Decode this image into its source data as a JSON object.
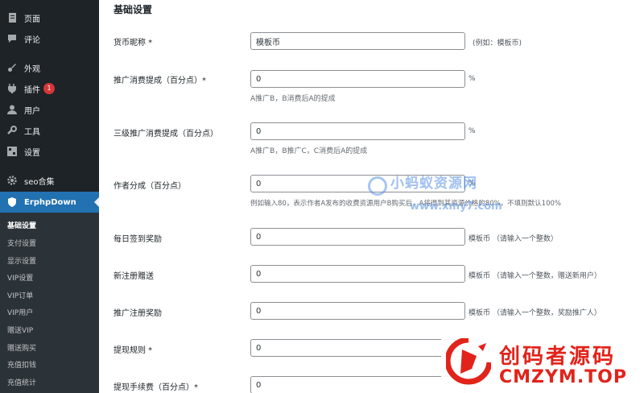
{
  "sidebar": {
    "menu": [
      {
        "label": "页面",
        "icon": "page-icon"
      },
      {
        "label": "评论",
        "icon": "comment-icon"
      },
      {
        "label": "外观",
        "icon": "brush-icon"
      },
      {
        "label": "插件",
        "icon": "plugin-icon",
        "badge": "1"
      },
      {
        "label": "用户",
        "icon": "user-icon"
      },
      {
        "label": "工具",
        "icon": "wrench-icon"
      },
      {
        "label": "设置",
        "icon": "settings-icon"
      },
      {
        "label": "seo合集",
        "icon": "gear-icon"
      },
      {
        "label": "ErphpDown",
        "icon": "shield-icon",
        "active": true
      }
    ],
    "submenu": [
      {
        "label": "基础设置",
        "current": true
      },
      {
        "label": "支付设置"
      },
      {
        "label": "显示设置"
      },
      {
        "label": "VIP设置"
      },
      {
        "label": "VIP订单"
      },
      {
        "label": "VIP用户"
      },
      {
        "label": "赠送VIP"
      },
      {
        "label": "赠送购买"
      },
      {
        "label": "充值扣钱"
      },
      {
        "label": "充值统计"
      }
    ]
  },
  "main": {
    "section_title": "基础设置",
    "rows": [
      {
        "label": "货币昵称 *",
        "value": "模板币",
        "suffix": "(例如：模板币)"
      },
      {
        "label": "推广消费提成（百分点）*",
        "value": "0",
        "suffix": "%",
        "hint": "A推广B，B消费后A的提成"
      },
      {
        "label": "三级推广消费提成（百分点）",
        "value": "0",
        "suffix": "%",
        "hint": "A推广B，B推广C，C消费后A的提成"
      },
      {
        "label": "作者分成（百分点）",
        "value": "0",
        "suffix": "%",
        "hint": "例如输入80，表示作者A发布的收费资源用户B购买后，A将得到其资源价格的80%，不填则默认100%"
      },
      {
        "label": "每日签到奖励",
        "value": "0",
        "suffix": "模板币 （请输入一个整数）"
      },
      {
        "label": "新注册赠送",
        "value": "0",
        "suffix": "模板币 （请输入一个整数，赠送新用户）"
      },
      {
        "label": "推广注册奖励",
        "value": "0",
        "suffix": "模板币 （请输入一个整数，奖励推广人）"
      },
      {
        "label": "提现规则 *",
        "value": "0"
      },
      {
        "label": "提现手续费（百分点）*",
        "value": "0"
      }
    ]
  },
  "watermark": {
    "center_main": "小蚂蚁资源网",
    "center_sub": "www.xmy7.com",
    "corner_cn": "创码者源码",
    "corner_en": "CMZYM.TOP"
  },
  "colors": {
    "sidebar_bg": "#1d2327",
    "submenu_bg": "#2c3338",
    "active_bg": "#2271b1",
    "badge": "#d63638",
    "corner_watermark": "#e2231a"
  }
}
